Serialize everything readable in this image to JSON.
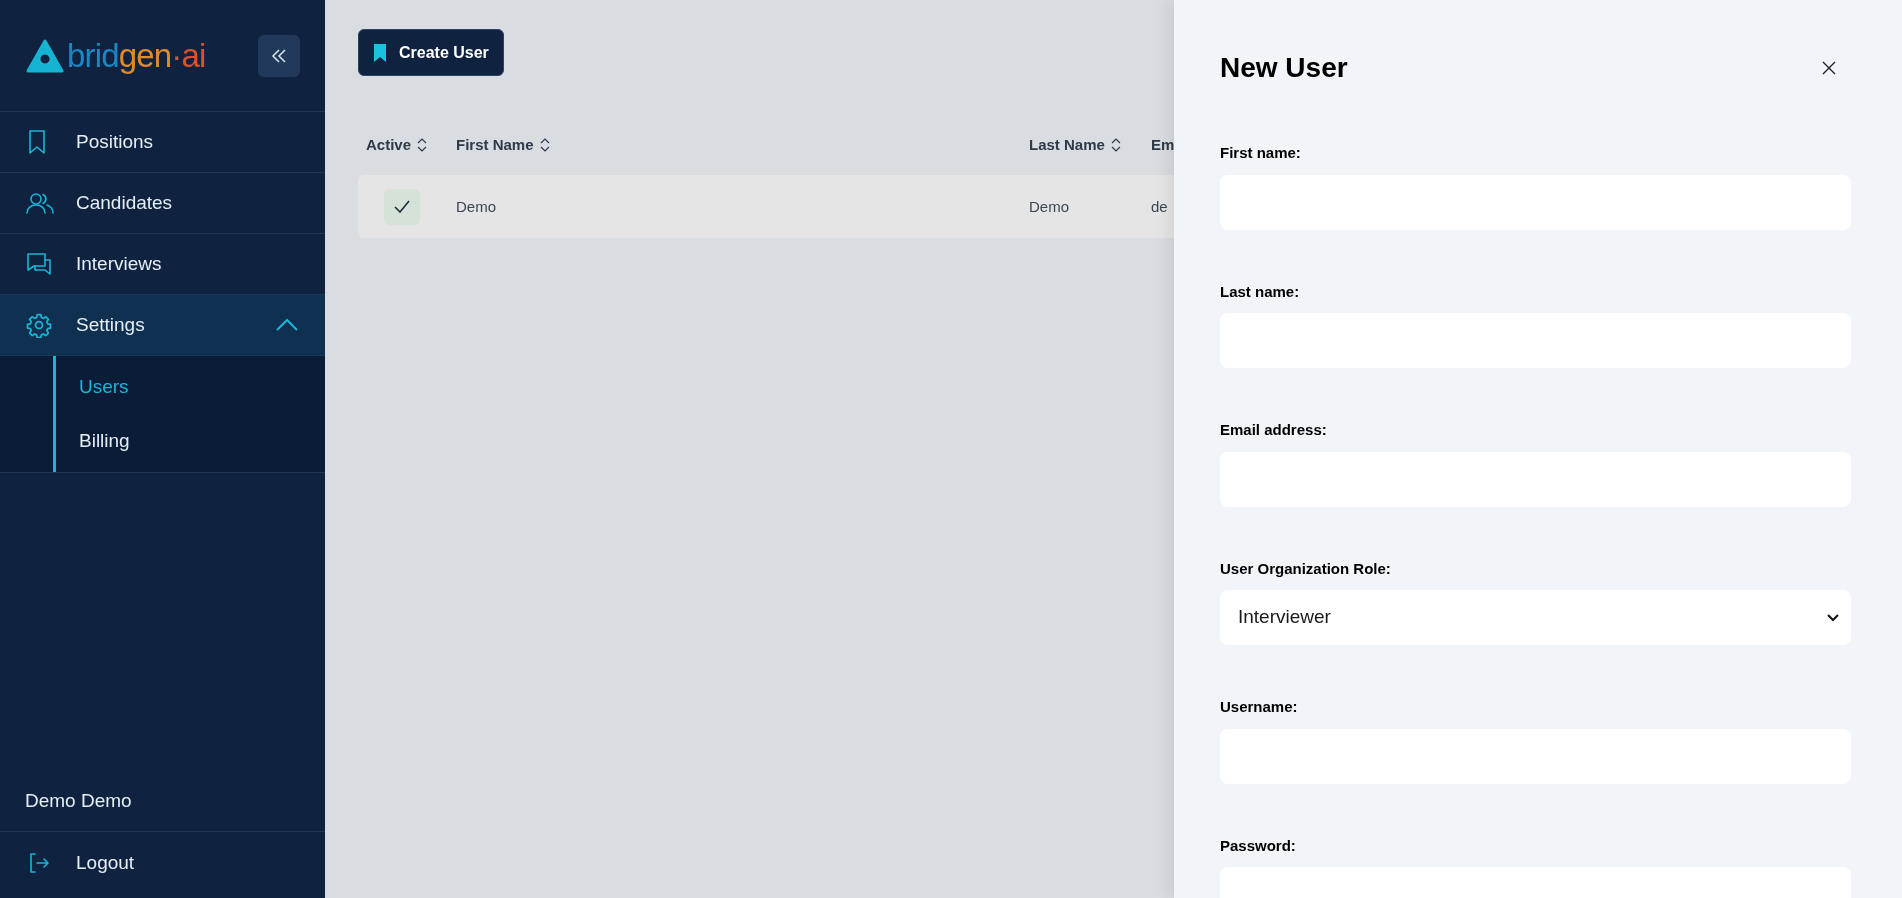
{
  "sidebar": {
    "logo": [
      {
        "text": "brid",
        "color": "#1a86c4"
      },
      {
        "text": "gen",
        "color": "#e08a2c"
      },
      {
        "text": "·ai",
        "color": "#d9532a"
      }
    ],
    "nav": [
      {
        "label": "Positions",
        "selected": false
      },
      {
        "label": "Candidates",
        "selected": false
      },
      {
        "label": "Interviews",
        "selected": false
      },
      {
        "label": "Settings",
        "selected": true,
        "expanded": true,
        "children": [
          {
            "label": "Users",
            "selected": true
          },
          {
            "label": "Billing",
            "selected": false
          }
        ]
      }
    ],
    "user_name": "Demo Demo",
    "logout": "Logout"
  },
  "toolbar": {
    "create_button": "Create User"
  },
  "table": {
    "columns": [
      {
        "label": "Active",
        "sortable": true
      },
      {
        "label": "First Name",
        "sortable": true
      },
      {
        "label": "Last Name",
        "sortable": true
      },
      {
        "label": "Em",
        "sortable": false
      }
    ],
    "rows": [
      {
        "cells": [
          {
            "checked": true
          },
          "Demo",
          "Demo",
          "de"
        ]
      }
    ]
  },
  "drawer": {
    "title": "New User",
    "fields": [
      {
        "label": "First name:",
        "kind": "text"
      },
      {
        "label": "Last name:",
        "kind": "text"
      },
      {
        "label": "Email address:",
        "kind": "text"
      },
      {
        "label": "User Organization Role:",
        "kind": "select",
        "value": "Interviewer"
      },
      {
        "label": "Username:",
        "kind": "text"
      },
      {
        "label": "Password:",
        "kind": "password"
      }
    ]
  }
}
